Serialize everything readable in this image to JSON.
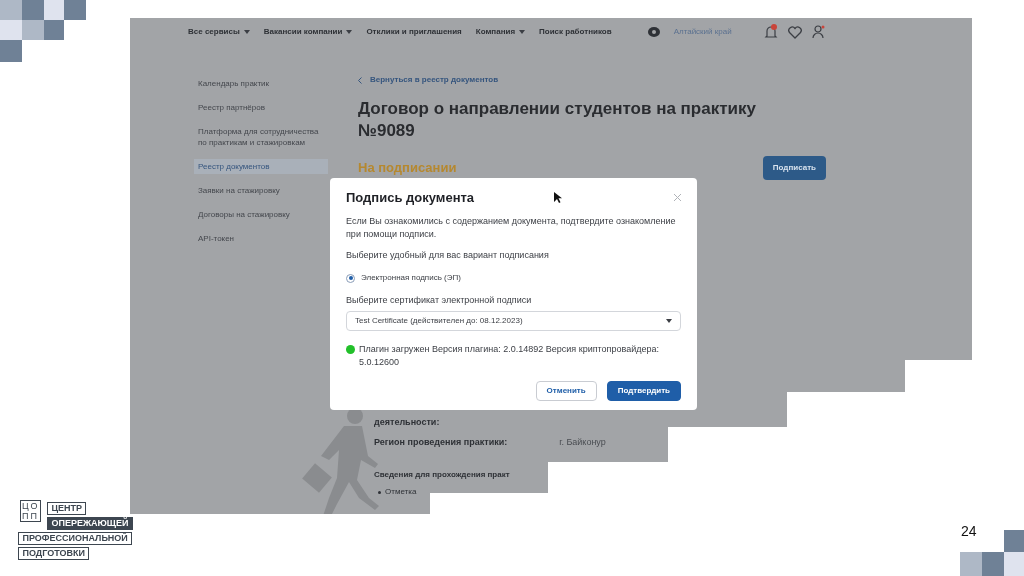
{
  "screenshot": {
    "nav": {
      "items": [
        {
          "label": "Все сервисы",
          "dropdown": true
        },
        {
          "label": "Вакансии компании",
          "dropdown": true
        },
        {
          "label": "Отклики и приглашения",
          "dropdown": false
        },
        {
          "label": "Компания",
          "dropdown": true
        },
        {
          "label": "Поиск работников",
          "dropdown": false
        }
      ],
      "region": "Алтайский край"
    },
    "sidebar": {
      "items": [
        {
          "label": "Календарь практик",
          "selected": false
        },
        {
          "label": "Реестр партнёров",
          "selected": false
        },
        {
          "label": "Платформа для сотрудничества по практикам и стажировкам",
          "selected": false
        },
        {
          "label": "Реестр документов",
          "selected": true
        },
        {
          "label": "Заявки на стажировку",
          "selected": false
        },
        {
          "label": "Договоры на стажировку",
          "selected": false
        },
        {
          "label": "API-токен",
          "selected": false
        }
      ]
    },
    "back_link": "Вернуться в реестр документов",
    "title": "Договор о направлении студентов на практику №9089",
    "status": "На подписании",
    "sign_button": "Подписать",
    "details": {
      "field_tail": "деятельности:",
      "region_label": "Регион проведения практики:",
      "region_value": "г. Байконур",
      "section_title": "Сведения для прохождения практ",
      "bullets": [
        "Отметка"
      ]
    },
    "modal": {
      "title": "Подпись документа",
      "intro": "Если Вы ознакомились с содержанием документа, подтвердите ознакомление при помощи подписи.",
      "method_prompt": "Выберите удобный для вас вариант подписания",
      "methods": [
        {
          "label": "Электронная подпись (ЭП)",
          "selected": true
        }
      ],
      "certificate_label": "Выберите сертификат электронной подписи",
      "certificate_value": "Test Certificate (действителен до: 08.12.2023)",
      "plugin_status": "Плагин загружен Версия плагина: 2.0.14892 Версия криптопровайдера: 5.0.12600",
      "plugin_loaded": true,
      "buttons": [
        {
          "label": "Отменить",
          "kind": "secondary"
        },
        {
          "label": "Подтвердить",
          "kind": "primary"
        }
      ]
    }
  },
  "slide": {
    "page_number": "24",
    "logo": {
      "mark": [
        "ЦО",
        "ПП"
      ],
      "lines": [
        {
          "text": "ЦЕНТР",
          "inverted": false
        },
        {
          "text": "ОПЕРЕЖАЮЩЕЙ",
          "inverted": true
        },
        {
          "text": "ПРОФЕССИОНАЛЬНОЙ",
          "inverted": false
        },
        {
          "text": "ПОДГОТОВКИ",
          "inverted": false
        }
      ]
    }
  }
}
